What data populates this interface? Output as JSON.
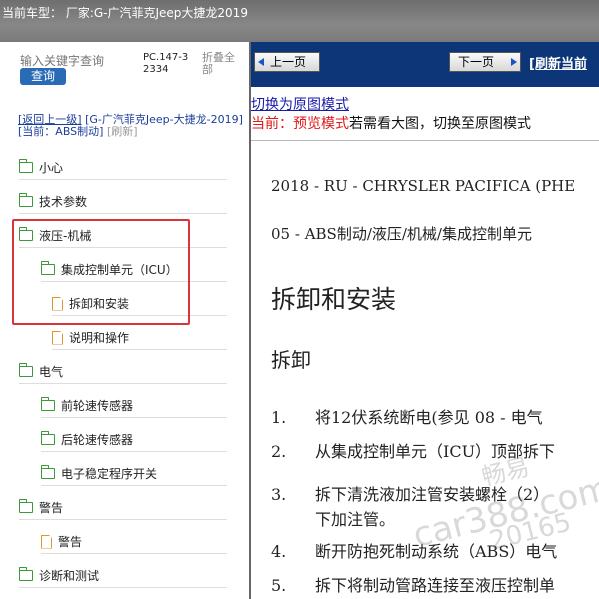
{
  "topbar": {
    "title": "当前车型：  厂家:G-广汽菲克Jeep大捷龙2019"
  },
  "sidebar": {
    "search_placeholder": "输入关键字查询",
    "query_label": "查询",
    "part_code": "PC.147-32334",
    "collapse_label": "折叠全部",
    "back_label": "[返回上一级]",
    "parent_label": "[G-广汽菲克Jeep-大捷龙-2019]",
    "current_label": "[当前：ABS制动]",
    "refresh_label": "[刷新]",
    "tree": [
      {
        "label": "小心",
        "icon": "folder-icon"
      },
      {
        "label": "技术参数",
        "icon": "folder-icon"
      },
      {
        "label": "液压-机械",
        "icon": "folder-icon"
      },
      {
        "label": "集成控制单元（ICU）",
        "icon": "folder-icon"
      },
      {
        "label": "拆卸和安装",
        "icon": "document-icon"
      },
      {
        "label": "说明和操作",
        "icon": "document-icon"
      },
      {
        "label": "电气",
        "icon": "folder-icon"
      },
      {
        "label": "前轮速传感器",
        "icon": "folder-icon"
      },
      {
        "label": "后轮速传感器",
        "icon": "folder-icon"
      },
      {
        "label": "电子稳定程序开关",
        "icon": "folder-icon"
      },
      {
        "label": "警告",
        "icon": "folder-icon"
      },
      {
        "label": "警告",
        "icon": "document-icon"
      },
      {
        "label": "诊断和测试",
        "icon": "folder-icon"
      }
    ]
  },
  "content": {
    "prev_label": "上一页",
    "next_label": "下一页",
    "refresh_label": "[刷新当前",
    "switch_link": "切换为原图模式",
    "preview_mode": "当前：预览模式",
    "preview_hint": "若需看大图，切换至原图模式",
    "doc_header": "2018 - RU - CHRYSLER PACIFICA (PHE",
    "doc_section": "05 - ABS制动/液压/机械/集成控制单元",
    "h1": "拆卸和安装",
    "h2": "拆卸",
    "steps": [
      {
        "num": "1.",
        "text": "将12伏系统断电(参见 08 - 电气",
        "cont": ""
      },
      {
        "num": "2.",
        "text": "从集成控制单元（ICU）顶部拆下",
        "cont": ""
      },
      {
        "num": "3.",
        "text": "拆下清洗液加注管安装螺栓（2）",
        "cont": "下加注管。"
      },
      {
        "num": "4.",
        "text": "断开防抱死制动系统（ABS）电气",
        "cont": ""
      },
      {
        "num": "5.",
        "text": "拆下将制动管路连接至液压控制单",
        "cont": ""
      }
    ]
  },
  "watermark": {
    "brand": "畅易",
    "site": "car388.com",
    "id": "20165"
  },
  "colors": {
    "highlight": "#d8363a",
    "navbar": "#0c3677",
    "folder": "#3c9a3c",
    "document": "#e1952f"
  }
}
